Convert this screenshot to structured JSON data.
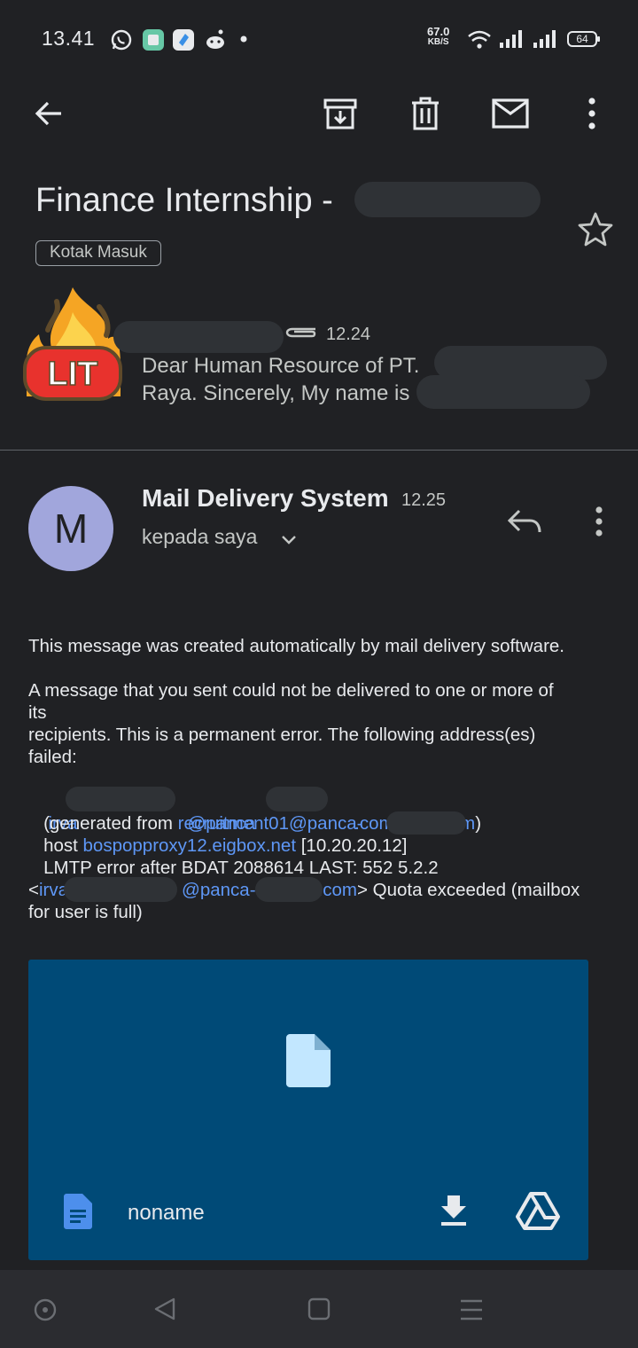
{
  "status_bar": {
    "time": "13.41",
    "net_speed_value": "67.0",
    "net_speed_unit": "KB/S",
    "battery": "64"
  },
  "toolbar": {
    "icons": [
      "back-arrow-icon",
      "archive-icon",
      "delete-icon",
      "mark-unread-icon",
      "more-vert-icon"
    ]
  },
  "thread": {
    "subject": "Finance Internship -",
    "label": "Kotak Masuk"
  },
  "collapsed_message": {
    "time": "12.24",
    "snippet_line1": "Dear Human Resource of PT.",
    "snippet_line2": "Raya. Sincerely, My name is",
    "avatar_text": "LIT"
  },
  "message": {
    "avatar_letter": "M",
    "sender": "Mail Delivery System",
    "time": "12.25",
    "recipient": "kepada saya",
    "body": {
      "line1": "This message was created automatically by mail delivery software.",
      "line2": "A message that you sent could not be delivered to one or more of",
      "line3": "its",
      "line4": "recipients. This is a permanent error. The following address(es)",
      "line5": "failed:",
      "addr_start": "irva",
      "addr_mid": "@panca",
      "addr_end": ".com",
      "gen_prefix": "   (generated from ",
      "gen_link": "recruitment01@panca-",
      "gen_link_end": "com",
      "gen_suffix": ")",
      "host_prefix": "   host ",
      "host_link": "bospopproxy12.eigbox.net",
      "host_suffix": " [10.20.20.12]",
      "lmtp": "   LMTP error after BDAT 2088614 LAST: 552 5.2.2",
      "lt": "<",
      "addr2_start": "irva",
      "addr2_mid": "@panca-",
      "addr2_end": ".com",
      "quota": "> Quota exceeded (mailbox",
      "last": "for user is full)"
    }
  },
  "attachment": {
    "name": "noname"
  },
  "nav_bar": {
    "icons": [
      "home-circle-icon",
      "back-triangle-icon",
      "recents-square-icon",
      "menu-lines-icon"
    ]
  }
}
